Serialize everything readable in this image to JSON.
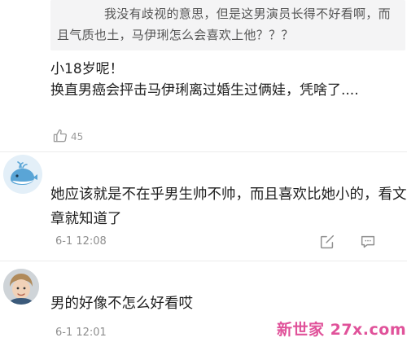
{
  "quote": {
    "text": "我没有歧视的意思，但是这男演员长得不好看啊，而且气质也土，马伊琍怎么会喜欢上他？？？"
  },
  "reply": {
    "line1": "小18岁呢！",
    "line2": "换直男癌会抨击马伊琍离过婚生过俩娃，凭啥了....",
    "like_count": "45"
  },
  "comments": [
    {
      "avatar": "whale-avatar",
      "text": "她应该就是不在乎男生帅不帅，而且喜欢比她小的，看文章就知道了",
      "time": "6-1 12:08"
    },
    {
      "avatar": "child-photo-avatar",
      "text": "男的好像不怎么好看哎",
      "time": "6-1 12:01"
    }
  ],
  "watermark": "新世家 27x.com",
  "colors": {
    "quote_bg": "#f4f4f5",
    "meta_gray": "#8e8e8e",
    "watermark": "#e0529a"
  }
}
